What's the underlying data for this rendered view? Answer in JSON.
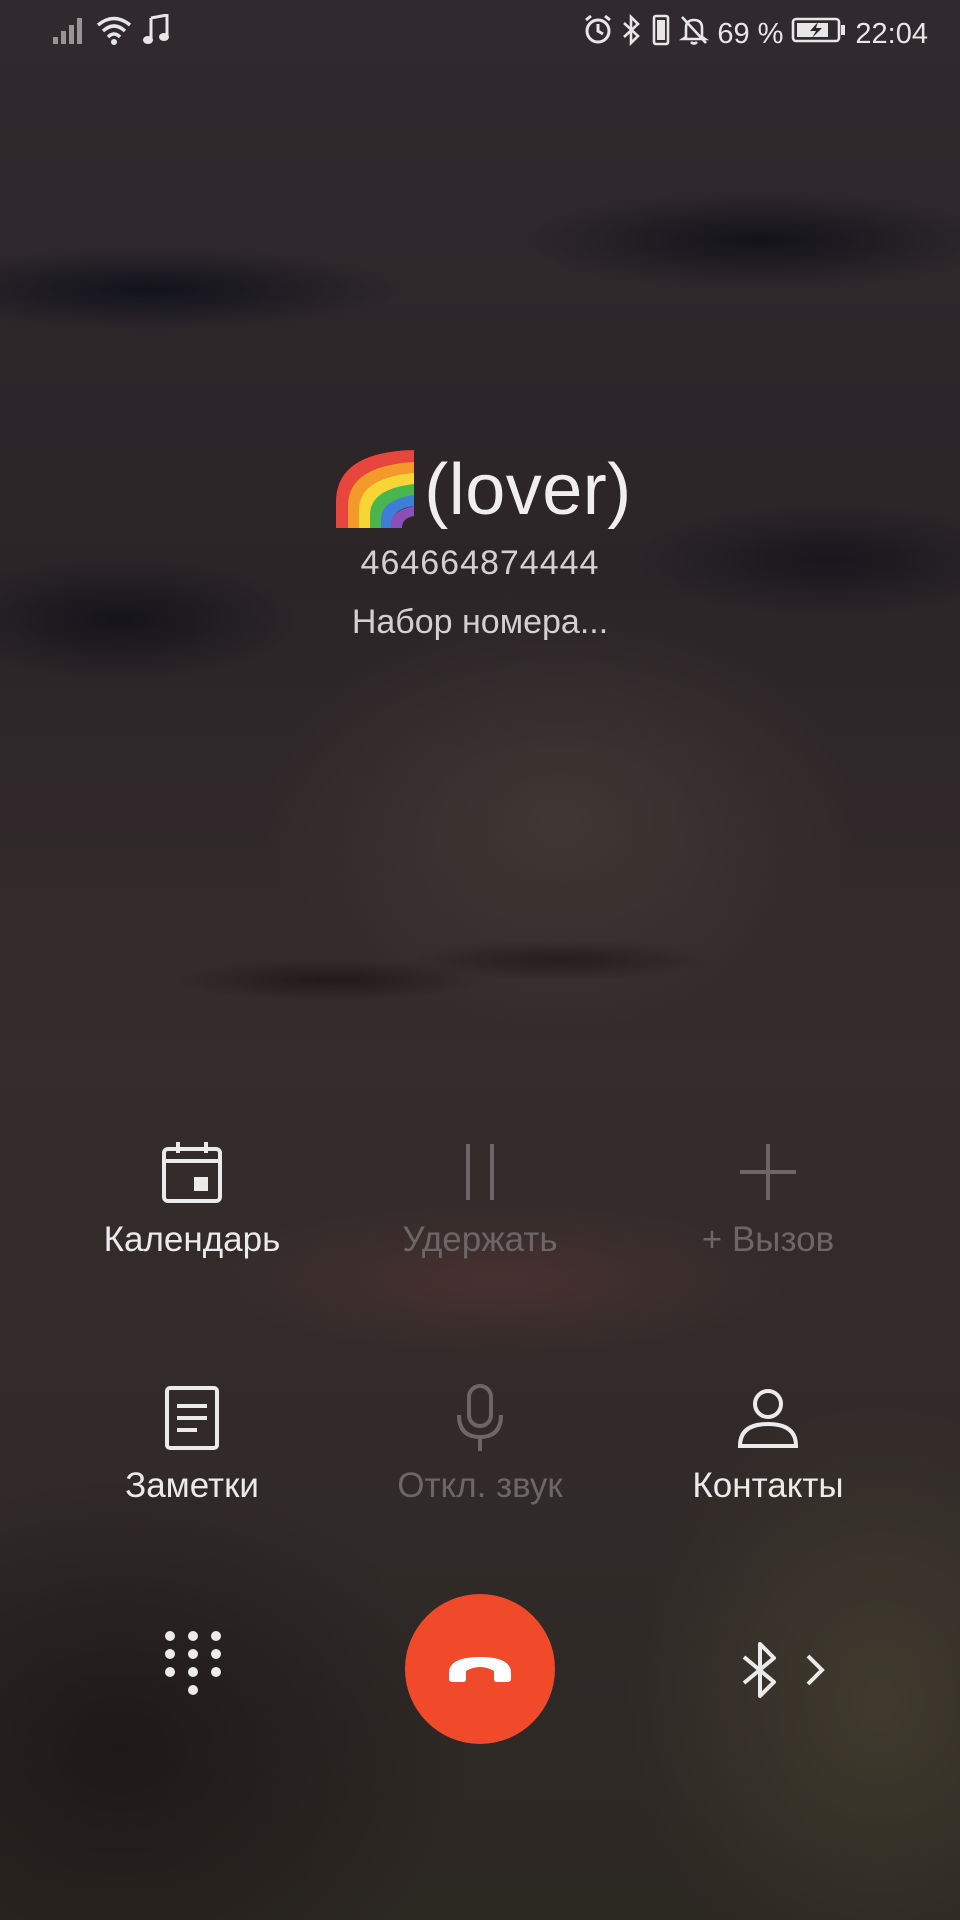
{
  "status_bar": {
    "battery_percent": "69 %",
    "time": "22:04",
    "icons_left": [
      "signal-icon",
      "wifi-icon",
      "music-note-icon"
    ],
    "icons_right": [
      "alarm-icon",
      "bluetooth-icon",
      "vibrate-icon",
      "mute-bell-icon",
      "battery-charging-icon"
    ]
  },
  "caller": {
    "emoji": "🌈",
    "name": "(lover)",
    "number": "464664874444",
    "status": "Набор номера..."
  },
  "actions": [
    {
      "label": "Календарь",
      "icon": "calendar-icon",
      "enabled": true
    },
    {
      "label": "Удержать",
      "icon": "pause-icon",
      "enabled": false
    },
    {
      "label": "+ Вызов",
      "icon": "plus-icon",
      "enabled": false
    },
    {
      "label": "Заметки",
      "icon": "notes-icon",
      "enabled": true
    },
    {
      "label": "Откл. звук",
      "icon": "microphone-icon",
      "enabled": false
    },
    {
      "label": "Контакты",
      "icon": "contact-icon",
      "enabled": true
    }
  ],
  "bottom": {
    "dialpad_icon": "dialpad-icon",
    "end_call_icon": "end-call-icon",
    "audio_route_icon": "bluetooth-icon",
    "colors": {
      "end_call": "#f04a2a"
    }
  }
}
